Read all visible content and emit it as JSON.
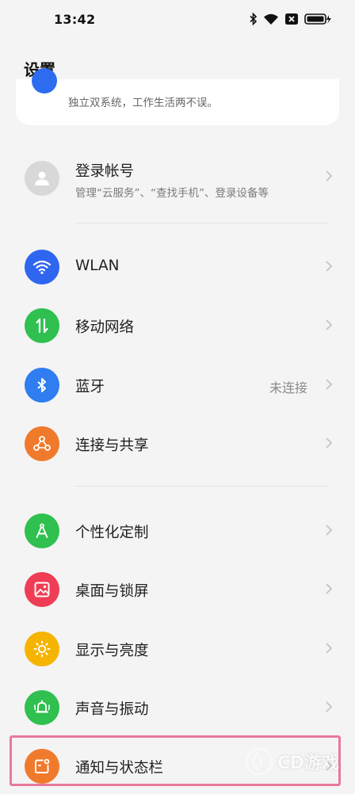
{
  "status_bar": {
    "time": "13:42"
  },
  "page": {
    "title": "设置"
  },
  "top_card": {
    "subtitle": "独立双系统，工作生活两不误。"
  },
  "account": {
    "title": "登录帐号",
    "subtitle": "管理“云服务”、“查找手机”、登录设备等"
  },
  "connectivity": [
    {
      "label": "WLAN",
      "icon": "wifi-icon",
      "color": "#2f66f0"
    },
    {
      "label": "移动网络",
      "icon": "mobile-data-icon",
      "color": "#2fc04f"
    },
    {
      "label": "蓝牙",
      "icon": "bluetooth-icon",
      "color": "#2f7df0",
      "value": "未连接"
    },
    {
      "label": "连接与共享",
      "icon": "share-icon",
      "color": "#f07a2c"
    }
  ],
  "personalization": [
    {
      "label": "个性化定制",
      "icon": "compass-icon",
      "color": "#2fc04f"
    },
    {
      "label": "桌面与锁屏",
      "icon": "wallpaper-icon",
      "color": "#ee3d55"
    },
    {
      "label": "显示与亮度",
      "icon": "sun-icon",
      "color": "#f5b400"
    },
    {
      "label": "声音与振动",
      "icon": "bell-icon",
      "color": "#2fc04f"
    },
    {
      "label": "通知与状态栏",
      "icon": "notification-icon",
      "color": "#f07a2c"
    }
  ],
  "watermark": {
    "text": "CD游戏"
  }
}
